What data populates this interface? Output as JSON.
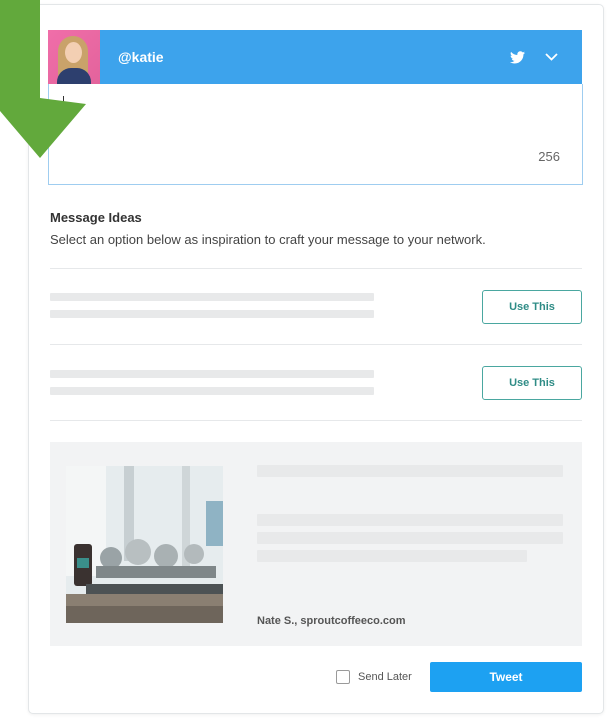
{
  "account": {
    "handle": "@katie",
    "network_icon": "twitter-bird-icon",
    "dropdown_icon": "chevron-down-icon",
    "bar_color": "#3da3ec"
  },
  "compose": {
    "char_count": "256"
  },
  "message_ideas": {
    "title": "Message Ideas",
    "subtitle": "Select an option below as inspiration to craft your message to your network.",
    "options": [
      {
        "button_label": "Use This"
      },
      {
        "button_label": "Use This"
      }
    ]
  },
  "preview": {
    "source": "Nate S., sproutcoffeeco.com"
  },
  "footer": {
    "send_later_label": "Send Later",
    "send_later_checked": false,
    "tweet_label": "Tweet",
    "tweet_color": "#1da1f2"
  },
  "overlay": {
    "arrow_color": "#62a93c"
  }
}
